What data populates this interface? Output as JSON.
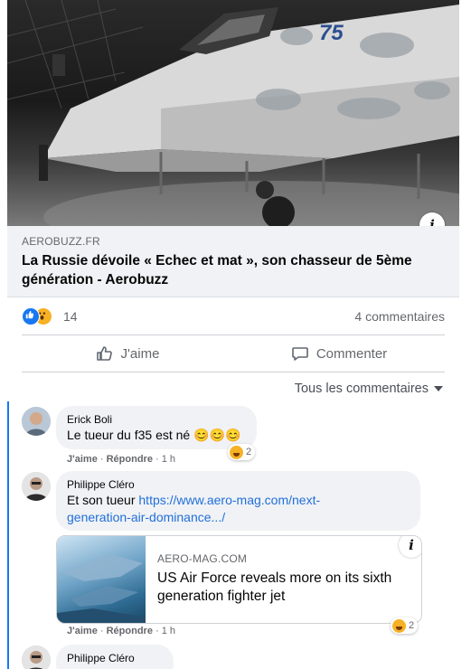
{
  "post": {
    "image_number": "75",
    "domain": "AEROBUZZ.FR",
    "headline": "La Russie dévoile « Echec et mat », son chasseur de 5ème génération - Aerobuzz",
    "reaction_count": "14",
    "comments_count": "4 commentaires",
    "like_label": "J'aime",
    "comment_label": "Commenter",
    "sort_label": "Tous les commentaires"
  },
  "comments": [
    {
      "author": "Erick Boli",
      "text": "Le tueur du f35 est né 😊😊😊",
      "like": "J'aime",
      "reply": "Répondre",
      "time": "· 1 h",
      "reactions": "2"
    },
    {
      "author": "Philippe Cléro",
      "text_prefix": "Et son tueur ",
      "link_line1": "https://www.aero-mag.com/next-",
      "link_line2": "generation-air-dominance.../",
      "like": "J'aime",
      "reply": "Répondre",
      "time": "· 1 h",
      "reactions": "2",
      "preview": {
        "domain": "AERO-MAG.COM",
        "title": "US Air Force reveals more on its sixth generation fighter jet"
      }
    },
    {
      "author": "Philippe Cléro"
    }
  ],
  "colors": {
    "accent": "#1877f2",
    "link": "#216fdb",
    "bubble": "#f0f2f5",
    "secondary_text": "#65676b"
  },
  "icons": [
    "info-icon",
    "like-reaction-icon",
    "wow-reaction-icon",
    "thumbs-up-icon",
    "comment-icon",
    "chevron-down-icon",
    "haha-reaction-icon"
  ]
}
